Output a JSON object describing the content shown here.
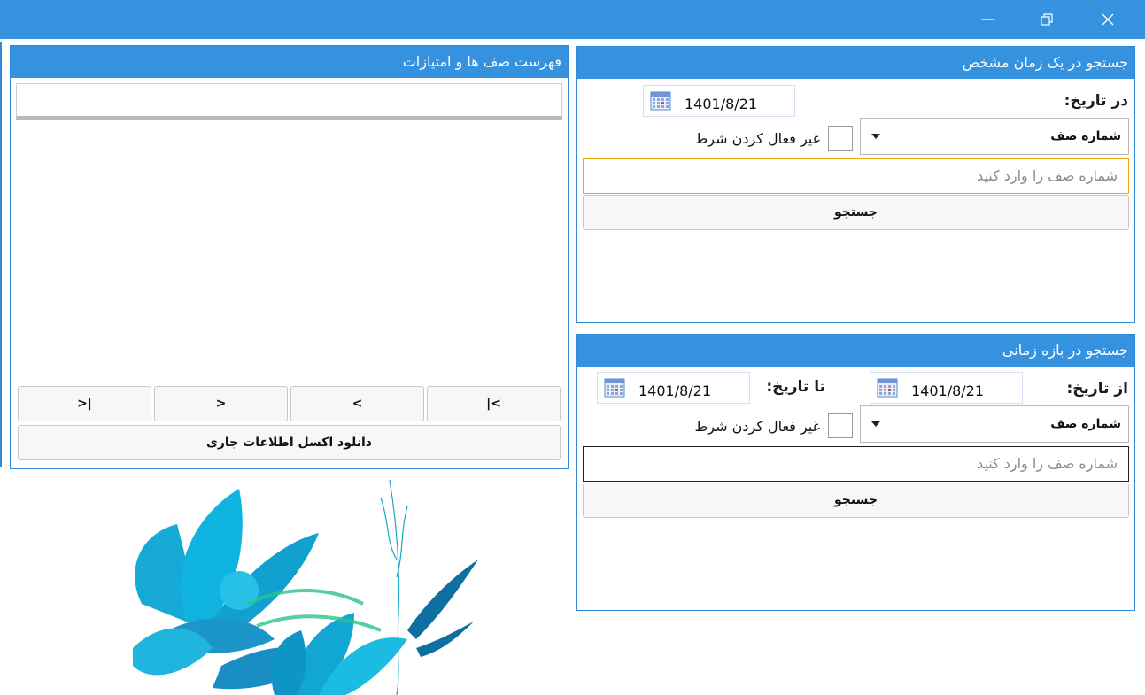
{
  "titlebar": {
    "minimize_icon": "minimize-icon",
    "maximize_icon": "restore-icon",
    "close_icon": "close-icon",
    "color": "#3592df"
  },
  "list_panel": {
    "title": "فهرست صف ها و امتیازات",
    "nav": {
      "first": "|<",
      "prev": "<",
      "next": ">",
      "last": ">|"
    },
    "download_label": "دانلود اکسل اطلاعات جاری"
  },
  "single_search": {
    "title": "جستجو در یک زمان مشخص",
    "date_label": "در تاریخ:",
    "date_value": "1401/8/21",
    "queue_select": "شماره صف",
    "disable_label": "غیر فعال کردن شرط",
    "input_placeholder": "شماره صف را وارد کنید",
    "search_label": "جستجو"
  },
  "range_search": {
    "title": "جستجو در بازه زمانی",
    "from_label": "از تاریخ:",
    "from_value": "1401/8/21",
    "to_label": "تا تاریخ:",
    "to_value": "1401/8/21",
    "queue_select": "شماره صف",
    "disable_label": "غیر فعال کردن شرط",
    "input_placeholder": "شماره صف را وارد کنید",
    "search_label": "جستجو"
  },
  "decor_image": "blue-flowers-illustration"
}
